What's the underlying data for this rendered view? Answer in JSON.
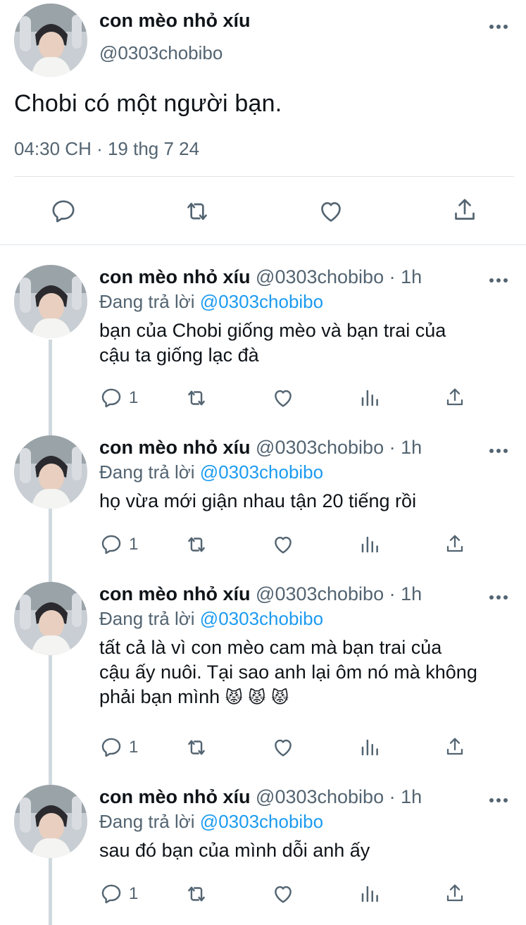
{
  "main_tweet": {
    "display_name": "con mèo nhỏ xíu",
    "handle": "@0303chobibo",
    "text": "Chobi có một người bạn.",
    "timestamp": "04:30 CH · 19 thg 7 24",
    "icons": {
      "more": "more-horizontal-icon",
      "reply": "reply-icon",
      "retweet": "retweet-icon",
      "like": "heart-icon",
      "share": "share-icon"
    }
  },
  "replies": [
    {
      "display_name": "con mèo nhỏ xíu",
      "meta": "@0303chobibo · 1h",
      "replying_prefix": "Đang trả lời",
      "replying_to": "@0303chobibo",
      "text_lines": [
        "bạn của Chobi giống mèo và bạn trai của",
        "cậu ta giống lạc đà"
      ],
      "reply_count": "1"
    },
    {
      "display_name": "con mèo nhỏ xíu",
      "meta": "@0303chobibo · 1h",
      "replying_prefix": "Đang trả lời",
      "replying_to": "@0303chobibo",
      "text_lines": [
        "họ vừa mới giận nhau tận 20 tiếng rồi"
      ],
      "reply_count": "1"
    },
    {
      "display_name": "con mèo nhỏ xíu",
      "meta": "@0303chobibo · 1h",
      "replying_prefix": "Đang trả lời",
      "replying_to": "@0303chobibo",
      "text_lines": [
        "tất cả là vì con mèo cam mà bạn trai của",
        "cậu ấy nuôi. Tại sao anh lại ôm nó mà không",
        "phải bạn mình"
      ],
      "emoji": "😾 😾 😾",
      "reply_count": "1"
    },
    {
      "display_name": "con mèo nhỏ xíu",
      "meta": "@0303chobibo · 1h",
      "replying_prefix": "Đang trả lời",
      "replying_to": "@0303chobibo",
      "text_lines": [
        "sau đó bạn của mình dỗi anh ấy"
      ],
      "reply_count": "1"
    }
  ],
  "colors": {
    "text": "#0f1419",
    "secondary": "#536471",
    "mention": "#1d9bf0",
    "divider": "#e1e6ea",
    "thread_line": "#cfd9de"
  }
}
